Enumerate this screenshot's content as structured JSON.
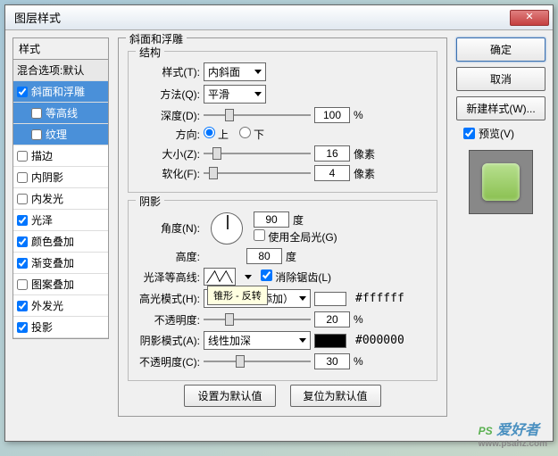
{
  "title": "图层样式",
  "left": {
    "header": "样式",
    "blend": "混合选项:默认",
    "items": [
      {
        "label": "斜面和浮雕",
        "checked": true,
        "selected": true
      },
      {
        "label": "等高线",
        "checked": false,
        "sub": true,
        "selected": true
      },
      {
        "label": "纹理",
        "checked": false,
        "sub": true,
        "selected": true
      },
      {
        "label": "描边",
        "checked": false
      },
      {
        "label": "内阴影",
        "checked": false
      },
      {
        "label": "内发光",
        "checked": false
      },
      {
        "label": "光泽",
        "checked": true
      },
      {
        "label": "颜色叠加",
        "checked": true
      },
      {
        "label": "渐变叠加",
        "checked": true
      },
      {
        "label": "图案叠加",
        "checked": false
      },
      {
        "label": "外发光",
        "checked": true
      },
      {
        "label": "投影",
        "checked": true
      }
    ]
  },
  "main": {
    "section_title": "斜面和浮雕",
    "struct": {
      "title": "结构",
      "style_label": "样式(T):",
      "style_value": "内斜面",
      "method_label": "方法(Q):",
      "method_value": "平滑",
      "depth_label": "深度(D):",
      "depth_value": "100",
      "depth_unit": "%",
      "dir_label": "方向:",
      "dir_up": "上",
      "dir_down": "下",
      "size_label": "大小(Z):",
      "size_value": "16",
      "size_unit": "像素",
      "soften_label": "软化(F):",
      "soften_value": "4",
      "soften_unit": "像素"
    },
    "shadow": {
      "title": "阴影",
      "angle_label": "角度(N):",
      "angle_value": "90",
      "angle_unit": "度",
      "global_label": "使用全局光(G)",
      "alt_label": "高度:",
      "alt_value": "80",
      "alt_unit": "度",
      "gloss_label": "光泽等高线:",
      "antialias_label": "消除锯齿(L)",
      "tooltip": "锥形 - 反转",
      "hl_mode_label": "高光模式(H):",
      "hl_mode_value": "线性减淡（添加）",
      "hl_color": "#ffffff",
      "hl_hex": "#ffffff",
      "hl_op_label": "不透明度:",
      "hl_op_value": "20",
      "hl_op_unit": "%",
      "sh_mode_label": "阴影模式(A):",
      "sh_mode_value": "线性加深",
      "sh_color": "#000000",
      "sh_hex": "#000000",
      "sh_op_label": "不透明度(C):",
      "sh_op_value": "30",
      "sh_op_unit": "%"
    },
    "btn_default": "设置为默认值",
    "btn_reset": "复位为默认值"
  },
  "right": {
    "ok": "确定",
    "cancel": "取消",
    "newstyle": "新建样式(W)...",
    "preview_label": "预览(V)"
  },
  "watermark": {
    "brand": "PS 爱好者",
    "url": "www.psahz.com"
  }
}
